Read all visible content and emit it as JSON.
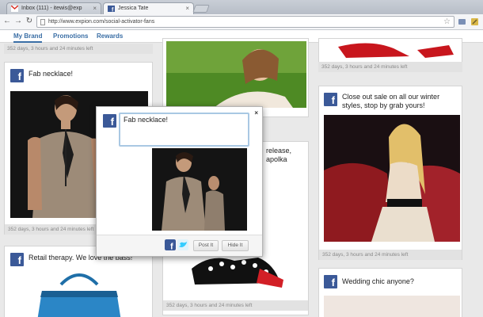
{
  "browser": {
    "tabs": [
      {
        "label": "Inbox (111) - itewis@exp",
        "icon": "gmail-icon"
      },
      {
        "label": "Jessica Tate",
        "icon": "facebook-icon"
      }
    ],
    "url": "http://www.expion.com/social-activator-fans"
  },
  "appnav": {
    "tabs": [
      {
        "label": "My Brand"
      },
      {
        "label": "Promotions"
      },
      {
        "label": "Rewards"
      }
    ]
  },
  "feed": {
    "meta_text": "352 days, 3 hours and 24 minutes left",
    "cards": [
      {
        "title": "Fab necklace!"
      },
      {
        "title": "Retail therapy.  We love the bass!"
      },
      {
        "title": "release, apolka"
      },
      {
        "title": "Close out sale on all our winter styles, stop by grab yours!"
      },
      {
        "title": "Wedding chic anyone?"
      }
    ]
  },
  "popup": {
    "message": "Fab necklace!",
    "close_label": "×",
    "post_label": "Post It",
    "hide_label": "Hide It"
  },
  "colors": {
    "facebook": "#3b5998",
    "twitter": "#33ccff",
    "link": "#3a6ea5"
  }
}
